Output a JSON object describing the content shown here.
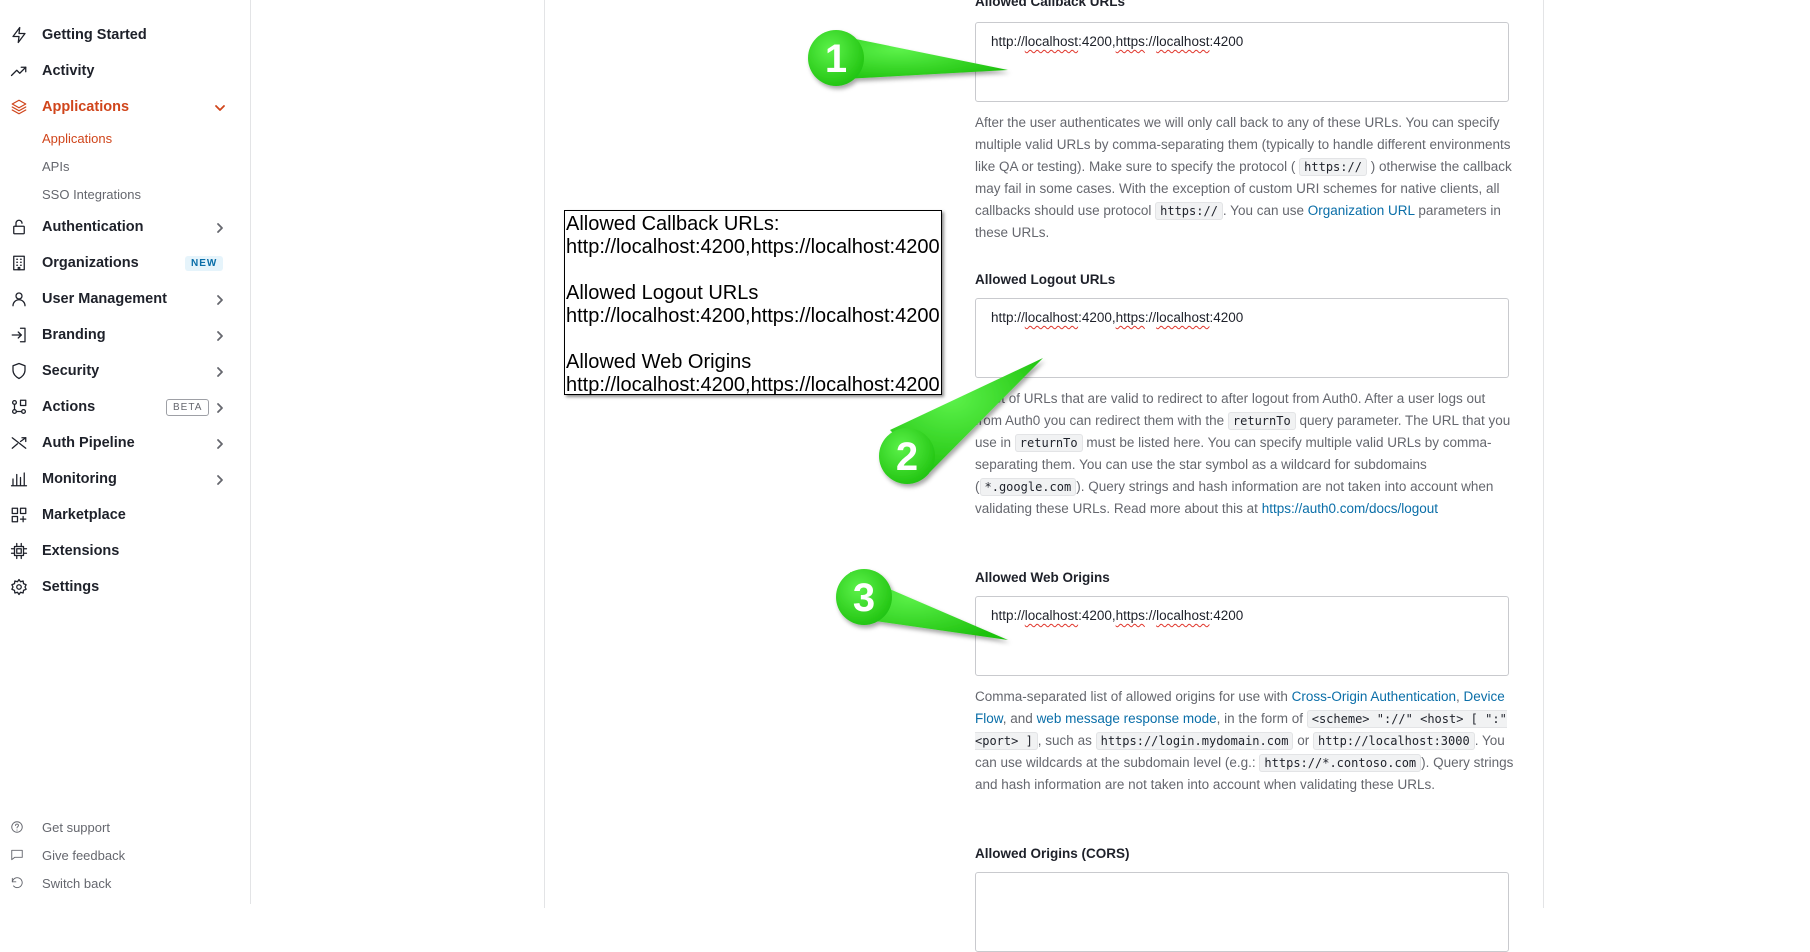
{
  "sidebar": {
    "items": [
      {
        "label": "Getting Started",
        "icon": "bolt-icon"
      },
      {
        "label": "Activity",
        "icon": "trend-icon"
      },
      {
        "label": "Applications",
        "icon": "layers-icon",
        "active": true
      },
      {
        "label": "Authentication",
        "icon": "lock-icon"
      },
      {
        "label": "Organizations",
        "icon": "building-icon",
        "badge": "NEW"
      },
      {
        "label": "User Management",
        "icon": "user-icon"
      },
      {
        "label": "Branding",
        "icon": "login-icon"
      },
      {
        "label": "Security",
        "icon": "shield-icon"
      },
      {
        "label": "Actions",
        "icon": "actions-icon",
        "badge": "BETA"
      },
      {
        "label": "Auth Pipeline",
        "icon": "pipeline-icon"
      },
      {
        "label": "Monitoring",
        "icon": "chart-icon"
      },
      {
        "label": "Marketplace",
        "icon": "grid-plus-icon"
      },
      {
        "label": "Extensions",
        "icon": "chip-icon"
      },
      {
        "label": "Settings",
        "icon": "gear-icon"
      }
    ],
    "subitems": [
      {
        "label": "Applications",
        "active": true
      },
      {
        "label": "APIs"
      },
      {
        "label": "SSO Integrations"
      }
    ],
    "footer": [
      {
        "label": "Get support",
        "icon": "help-icon"
      },
      {
        "label": "Give feedback",
        "icon": "chat-icon"
      },
      {
        "label": "Switch back",
        "icon": "undo-icon"
      }
    ]
  },
  "colors": {
    "accent": "#d0451b",
    "link": "#0a6ea8",
    "callout_green": "#22dd11"
  },
  "fields": {
    "callback": {
      "label": "Allowed Callback URLs",
      "value_part1": "http://",
      "value_part2": "localhost",
      "value_part3": ":4200,",
      "value_part4": "https",
      "value_part5": "://",
      "value_part6": "localhost",
      "value_part7": ":4200",
      "help_1": "After the user authenticates we will only call back to any of these URLs. You can specify multiple valid URLs by comma-separating them (typically to handle different environments like QA or testing). Make sure to specify the protocol (",
      "help_code1": "https://",
      "help_2": ") otherwise the callback may fail in some cases. With the exception of custom URI schemes for native clients, all callbacks should use protocol",
      "help_code2": "https://",
      "help_3": ". You can use",
      "help_link": "Organization URL",
      "help_4": "parameters in these URLs."
    },
    "logout": {
      "label": "Allowed Logout URLs",
      "value_part1": "http://",
      "value_part2": "localhost",
      "value_part3": ":4200,",
      "value_part4": "https",
      "value_part5": "://",
      "value_part6": "localhost",
      "value_part7": ":4200",
      "help_1": "A set of URLs that are valid to redirect to after logout from Auth0. After a user logs out from Auth0 you can redirect them with the",
      "help_code1": "returnTo",
      "help_2": "query parameter. The URL that you use in",
      "help_code2": "returnTo",
      "help_3": "must be listed here. You can specify multiple valid URLs by comma-separating them. You can use the star symbol as a wildcard for subdomains (",
      "help_code3": "*.google.com",
      "help_4": "). Query strings and hash information are not taken into account when validating these URLs. Read more about this at",
      "help_link": "https://auth0.com/docs/logout"
    },
    "web_origins": {
      "label": "Allowed Web Origins",
      "value_part1": "http://",
      "value_part2": "localhost",
      "value_part3": ":4200,",
      "value_part4": "https",
      "value_part5": "://",
      "value_part6": "localhost",
      "value_part7": ":4200",
      "help_1": "Comma-separated list of allowed origins for use with",
      "help_link1": "Cross-Origin Authentication",
      "help_sep": ",",
      "help_link2": "Device Flow",
      "help_2": ", and",
      "help_link3": "web message response mode",
      "help_3": ", in the form of",
      "help_code1": "<scheme> \"://\" <host> [ \":\" <port> ]",
      "help_4": ", such as",
      "help_code2": "https://login.mydomain.com",
      "help_5": "or",
      "help_code3": "http://localhost:3000",
      "help_6": ". You can use wildcards at the subdomain level (e.g.:",
      "help_code4": "https://*.contoso.com",
      "help_7": "). Query strings and hash information are not taken into account when validating these URLs."
    },
    "cors": {
      "label": "Allowed Origins (CORS)",
      "value": ""
    }
  },
  "note": {
    "line1": "Allowed Callback URLs:",
    "line2": "http://localhost:4200,https://localhost:4200",
    "line3": "Allowed Logout URLs",
    "line4": "http://localhost:4200,https://localhost:4200",
    "line5": "Allowed Web Origins",
    "line6": "http://localhost:4200,https://localhost:4200"
  },
  "callouts": [
    "1",
    "2",
    "3"
  ]
}
